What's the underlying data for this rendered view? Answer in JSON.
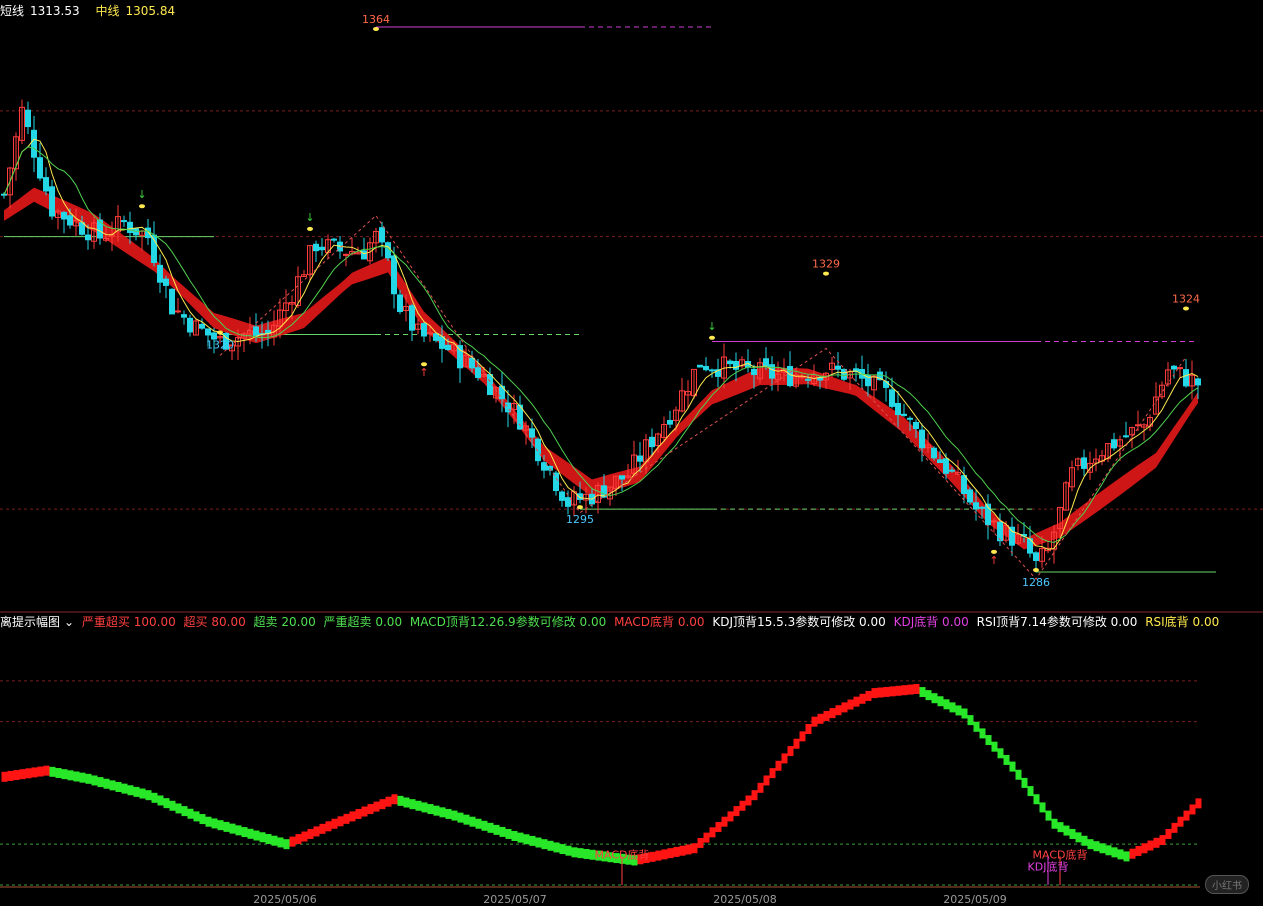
{
  "colors": {
    "bg": "#000000",
    "up": "#ff3c3c",
    "down": "#23d7e6",
    "fast_line": "#ffe94f",
    "slow_line": "#4fd04f",
    "ribbon": "#e01818",
    "support": "#6ad66a",
    "resistance": "#d03cd0",
    "osc_up": "#ff1414",
    "osc_down": "#28e628",
    "grid": "#7a1f1f"
  },
  "top_legend": [
    {
      "label": "短线",
      "value": "1313.53",
      "color": "#ffffff"
    },
    {
      "label": "中线",
      "value": "1305.84",
      "color": "#ffe94f"
    }
  ],
  "osc_legend": [
    {
      "text": "离提示幅图",
      "color": "#ffffff"
    },
    {
      "text": "严重超买 100.00",
      "color": "#ff4040"
    },
    {
      "text": "超买 80.00",
      "color": "#ff4040"
    },
    {
      "text": "超卖 20.00",
      "color": "#50e050"
    },
    {
      "text": "严重超卖 0.00",
      "color": "#50e050"
    },
    {
      "text": "MACD顶背12.26.9参数可修改 0.00",
      "color": "#50e050"
    },
    {
      "text": "MACD底背 0.00",
      "color": "#ff4040"
    },
    {
      "text": "KDJ顶背15.5.3参数可修改 0.00",
      "color": "#ffffff"
    },
    {
      "text": "KDJ底背 0.00",
      "color": "#e040e0"
    },
    {
      "text": "RSI顶背7.14参数可修改 0.00",
      "color": "#ffffff"
    },
    {
      "text": "RSI底背 0.00",
      "color": "#ffe94f"
    }
  ],
  "dates": [
    "2025/05/06",
    "2025/05/07",
    "2025/05/08",
    "2025/05/09"
  ],
  "watermark": "小红书",
  "chart_data": [
    {
      "type": "candlestick",
      "title": "",
      "ylim": [
        1282,
        1365
      ],
      "extremes": [
        {
          "label": "1364",
          "x": 62,
          "kind": "high"
        },
        {
          "label": "1320",
          "x": 36,
          "kind": "low"
        },
        {
          "label": "1295",
          "x": 96,
          "kind": "low"
        },
        {
          "label": "1329",
          "x": 137,
          "kind": "high"
        },
        {
          "label": "1286",
          "x": 172,
          "kind": "low"
        },
        {
          "label": "1324",
          "x": 197,
          "kind": "high"
        }
      ],
      "anchors": [
        [
          0,
          1340
        ],
        [
          3,
          1352
        ],
        [
          8,
          1338
        ],
        [
          12,
          1336
        ],
        [
          16,
          1334
        ],
        [
          20,
          1336
        ],
        [
          24,
          1334
        ],
        [
          28,
          1324
        ],
        [
          32,
          1321
        ],
        [
          36,
          1319
        ],
        [
          40,
          1320
        ],
        [
          44,
          1320
        ],
        [
          48,
          1326
        ],
        [
          52,
          1333
        ],
        [
          56,
          1332
        ],
        [
          60,
          1332
        ],
        [
          62,
          1334
        ],
        [
          64,
          1330
        ],
        [
          66,
          1324
        ],
        [
          69,
          1320
        ],
        [
          74,
          1318
        ],
        [
          80,
          1314
        ],
        [
          86,
          1308
        ],
        [
          90,
          1302
        ],
        [
          94,
          1296
        ],
        [
          98,
          1297
        ],
        [
          104,
          1300
        ],
        [
          112,
          1310
        ],
        [
          116,
          1316
        ],
        [
          122,
          1315
        ],
        [
          130,
          1314
        ],
        [
          137,
          1315
        ],
        [
          142,
          1314
        ],
        [
          148,
          1311
        ],
        [
          152,
          1306
        ],
        [
          158,
          1300
        ],
        [
          162,
          1295
        ],
        [
          166,
          1292
        ],
        [
          170,
          1290
        ],
        [
          172,
          1287
        ],
        [
          174,
          1289
        ],
        [
          178,
          1300
        ],
        [
          182,
          1303
        ],
        [
          186,
          1305
        ],
        [
          190,
          1307
        ],
        [
          194,
          1315
        ],
        [
          199,
          1313
        ]
      ],
      "ribbon_anchors": [
        [
          0,
          1337
        ],
        [
          5,
          1340
        ],
        [
          15,
          1336
        ],
        [
          25,
          1330
        ],
        [
          35,
          1322
        ],
        [
          42,
          1320
        ],
        [
          50,
          1322
        ],
        [
          58,
          1328
        ],
        [
          64,
          1330
        ],
        [
          70,
          1322
        ],
        [
          80,
          1314
        ],
        [
          90,
          1303
        ],
        [
          98,
          1298
        ],
        [
          106,
          1300
        ],
        [
          112,
          1306
        ],
        [
          118,
          1311
        ],
        [
          126,
          1314
        ],
        [
          134,
          1314
        ],
        [
          142,
          1312
        ],
        [
          150,
          1307
        ],
        [
          158,
          1300
        ],
        [
          164,
          1294
        ],
        [
          170,
          1290
        ],
        [
          176,
          1292
        ],
        [
          184,
          1297
        ],
        [
          192,
          1302
        ],
        [
          199,
          1311
        ]
      ],
      "ribbon_width": 2.5,
      "signals": [
        {
          "x": 23,
          "type": "sell"
        },
        {
          "x": 51,
          "type": "sell"
        },
        {
          "x": 118,
          "type": "sell"
        },
        {
          "x": 70,
          "type": "buy"
        },
        {
          "x": 165,
          "type": "buy"
        }
      ],
      "levels": [
        {
          "y": 1334,
          "x0": 0,
          "x1": 35,
          "kind": "support",
          "dash": false
        },
        {
          "y": 1320,
          "x0": 36,
          "x1": 62,
          "kind": "support",
          "dash": false
        },
        {
          "y": 1320,
          "x0": 62,
          "x1": 96,
          "kind": "support",
          "dash": true
        },
        {
          "y": 1295,
          "x0": 96,
          "x1": 118,
          "kind": "support",
          "dash": false
        },
        {
          "y": 1295,
          "x0": 118,
          "x1": 172,
          "kind": "support",
          "dash": true
        },
        {
          "y": 1286,
          "x0": 172,
          "x1": 202,
          "kind": "support",
          "dash": false
        },
        {
          "y": 1364,
          "x0": 62,
          "x1": 96,
          "kind": "resistance",
          "dash": false
        },
        {
          "y": 1364,
          "x0": 96,
          "x1": 118,
          "kind": "resistance",
          "dash": true
        },
        {
          "y": 1319,
          "x0": 118,
          "x1": 172,
          "kind": "resistance",
          "dash": false
        },
        {
          "y": 1319,
          "x0": 172,
          "x1": 199,
          "kind": "resistance",
          "dash": true
        }
      ]
    },
    {
      "type": "bar",
      "title": "",
      "ylim": [
        0,
        120
      ],
      "thresholds": [
        100,
        80,
        20,
        0
      ],
      "anchors": [
        [
          0,
          53
        ],
        [
          7,
          56
        ],
        [
          14,
          52
        ],
        [
          24,
          44
        ],
        [
          34,
          31
        ],
        [
          47,
          20
        ],
        [
          55,
          30
        ],
        [
          65,
          42
        ],
        [
          75,
          34
        ],
        [
          85,
          24
        ],
        [
          95,
          16
        ],
        [
          105,
          12
        ],
        [
          115,
          18
        ],
        [
          125,
          44
        ],
        [
          135,
          80
        ],
        [
          145,
          94
        ],
        [
          152,
          96
        ],
        [
          160,
          84
        ],
        [
          168,
          58
        ],
        [
          175,
          30
        ],
        [
          181,
          20
        ],
        [
          187,
          14
        ],
        [
          193,
          22
        ],
        [
          199,
          40
        ]
      ],
      "annotations": [
        {
          "x": 103,
          "label": "MACD底背",
          "color": "#ff4040"
        },
        {
          "x": 176,
          "label": "MACD底背",
          "color": "#ff4040"
        },
        {
          "x": 174,
          "label": "KDJ底背",
          "color": "#e040e0"
        }
      ]
    }
  ]
}
